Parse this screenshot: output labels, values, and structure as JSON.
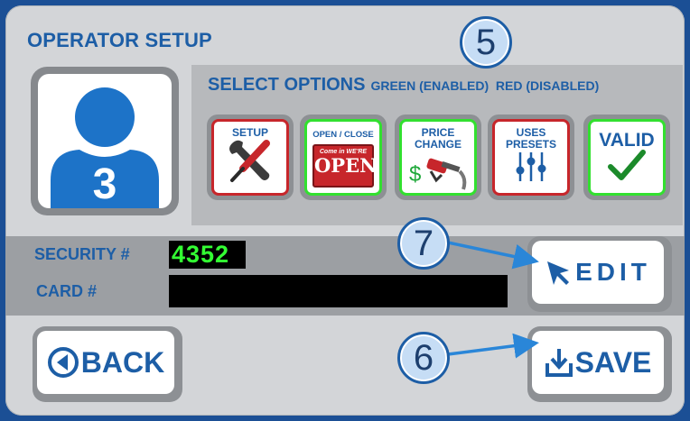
{
  "title": "OPERATOR SETUP",
  "operator": {
    "number": "3"
  },
  "options": {
    "header": "SELECT OPTIONS",
    "legend": "GREEN (ENABLED)  RED (DISABLED)",
    "items": [
      {
        "label": "SETUP",
        "state": "disabled",
        "icon": "wrench-screwdriver-icon"
      },
      {
        "label": "OPEN / CLOSE",
        "state": "enabled",
        "icon": "open-sign-icon",
        "sign_top": "Come in WE'RE",
        "sign_bottom": "OPEN"
      },
      {
        "label": "PRICE CHANGE",
        "state": "enabled",
        "icon": "fuel-nozzle-dollar-icon",
        "symbol": "$"
      },
      {
        "label": "USES PRESETS",
        "state": "disabled",
        "icon": "sliders-icon"
      },
      {
        "label": "VALID",
        "state": "enabled",
        "icon": "checkmark-icon"
      }
    ]
  },
  "security": {
    "security_label": "SECURITY #",
    "security_value": "4352",
    "card_label": "CARD #",
    "card_value": ""
  },
  "buttons": {
    "edit": "EDIT",
    "back": "BACK",
    "save": "SAVE"
  },
  "callouts": {
    "five": "5",
    "six": "6",
    "seven": "7"
  },
  "colors": {
    "brand_blue": "#1d5ea6",
    "enabled": "#32e02f",
    "disabled": "#c7262b",
    "security_text": "#33ff33"
  }
}
